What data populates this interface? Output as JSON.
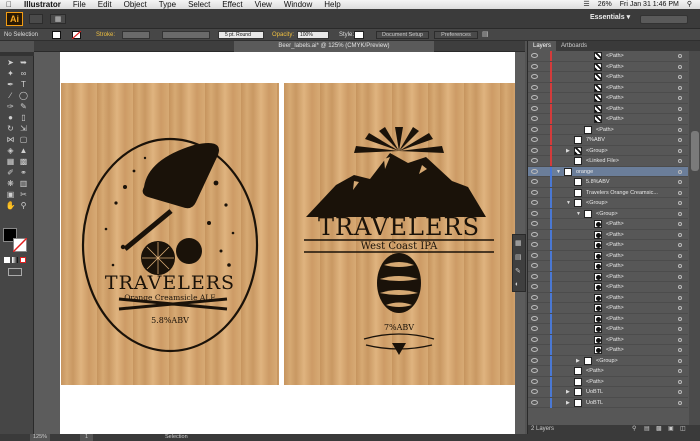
{
  "menubar": {
    "apple": "",
    "app": "Illustrator",
    "items": [
      "File",
      "Edit",
      "Object",
      "Type",
      "Select",
      "Effect",
      "View",
      "Window",
      "Help"
    ],
    "battery": "26%",
    "clock": "Fri Jan 31  1:46 PM"
  },
  "approw": {
    "logo": "Ai",
    "workspace": "Essentials ▾"
  },
  "control": {
    "selection": "No Selection",
    "stroke_label": "Stroke:",
    "brush": "5 pt. Round",
    "opacity_label": "Opacity:",
    "opacity": "100%",
    "style_label": "Style:",
    "doc_setup": "Document Setup",
    "preferences": "Preferences"
  },
  "document": {
    "tab": "Beer_labels.ai* @ 125% (CMYK/Preview)"
  },
  "labels": {
    "left": {
      "brand": "TRAVELERS",
      "flavor": "Orange Creamsicle ALE",
      "abv": "5.8%ABV"
    },
    "right": {
      "brand": "TRAVELERS",
      "style": "West Coast IPA",
      "abv": "7%ABV"
    }
  },
  "colors": {
    "accent_red": "#d43b3b",
    "accent_blue": "#4a78d4",
    "selection": "#6b7e9a",
    "ai_orange": "#f7a823"
  },
  "panel": {
    "tabs": [
      "Layers",
      "Artboards"
    ],
    "rows": [
      {
        "name": "<Path>",
        "indent": 3,
        "thumb": "dark",
        "line": "red"
      },
      {
        "name": "<Path>",
        "indent": 3,
        "thumb": "dark",
        "line": "red"
      },
      {
        "name": "<Path>",
        "indent": 3,
        "thumb": "dark",
        "line": "red"
      },
      {
        "name": "<Path>",
        "indent": 3,
        "thumb": "dark",
        "line": "red"
      },
      {
        "name": "<Path>",
        "indent": 3,
        "thumb": "dark",
        "line": "red"
      },
      {
        "name": "<Path>",
        "indent": 3,
        "thumb": "dark",
        "line": "red"
      },
      {
        "name": "<Path>",
        "indent": 3,
        "thumb": "dark",
        "line": "red"
      },
      {
        "name": "<Path>",
        "indent": 2,
        "thumb": "white",
        "line": "red"
      },
      {
        "name": "7%ABV",
        "indent": 1,
        "thumb": "white",
        "line": "red"
      },
      {
        "name": "<Group>",
        "indent": 1,
        "thumb": "dark",
        "line": "red",
        "tri": "▶"
      },
      {
        "name": "<Linked File>",
        "indent": 1,
        "thumb": "wood",
        "line": "red"
      },
      {
        "name": "orange",
        "indent": 0,
        "thumb": "wood",
        "line": "blue",
        "tri": "▼",
        "sel": true
      },
      {
        "name": "5.8%ABV",
        "indent": 1,
        "thumb": "white",
        "line": "blue"
      },
      {
        "name": "Travelers  Orange Creamsic...",
        "indent": 1,
        "thumb": "white",
        "line": "blue"
      },
      {
        "name": "<Group>",
        "indent": 1,
        "thumb": "white",
        "line": "blue",
        "tri": "▼"
      },
      {
        "name": "<Group>",
        "indent": 2,
        "thumb": "white",
        "line": "blue",
        "tri": "▼"
      },
      {
        "name": "<Path>",
        "indent": 3,
        "thumb": "blob",
        "line": "blue"
      },
      {
        "name": "<Path>",
        "indent": 3,
        "thumb": "blob",
        "line": "blue"
      },
      {
        "name": "<Path>",
        "indent": 3,
        "thumb": "blob",
        "line": "blue"
      },
      {
        "name": "<Path>",
        "indent": 3,
        "thumb": "blob",
        "line": "blue"
      },
      {
        "name": "<Path>",
        "indent": 3,
        "thumb": "blob",
        "line": "blue"
      },
      {
        "name": "<Path>",
        "indent": 3,
        "thumb": "blob",
        "line": "blue"
      },
      {
        "name": "<Path>",
        "indent": 3,
        "thumb": "blob",
        "line": "blue"
      },
      {
        "name": "<Path>",
        "indent": 3,
        "thumb": "blob",
        "line": "blue"
      },
      {
        "name": "<Path>",
        "indent": 3,
        "thumb": "blob",
        "line": "blue"
      },
      {
        "name": "<Path>",
        "indent": 3,
        "thumb": "blob",
        "line": "blue"
      },
      {
        "name": "<Path>",
        "indent": 3,
        "thumb": "blob",
        "line": "blue"
      },
      {
        "name": "<Path>",
        "indent": 3,
        "thumb": "blob",
        "line": "blue"
      },
      {
        "name": "<Path>",
        "indent": 3,
        "thumb": "blob",
        "line": "blue"
      },
      {
        "name": "<Group>",
        "indent": 2,
        "thumb": "white",
        "line": "blue",
        "tri": "▶"
      },
      {
        "name": "<Path>",
        "indent": 1,
        "thumb": "white",
        "line": "blue"
      },
      {
        "name": "<Path>",
        "indent": 1,
        "thumb": "white",
        "line": "blue"
      },
      {
        "name": "UoBTL",
        "indent": 1,
        "thumb": "white",
        "line": "blue",
        "tri": "▶"
      },
      {
        "name": "UoBTL",
        "indent": 1,
        "thumb": "white",
        "line": "blue",
        "tri": "▶"
      }
    ],
    "footer": "2 Layers"
  },
  "status": {
    "zoom": "125%",
    "page": "1",
    "mode": "Selection"
  }
}
